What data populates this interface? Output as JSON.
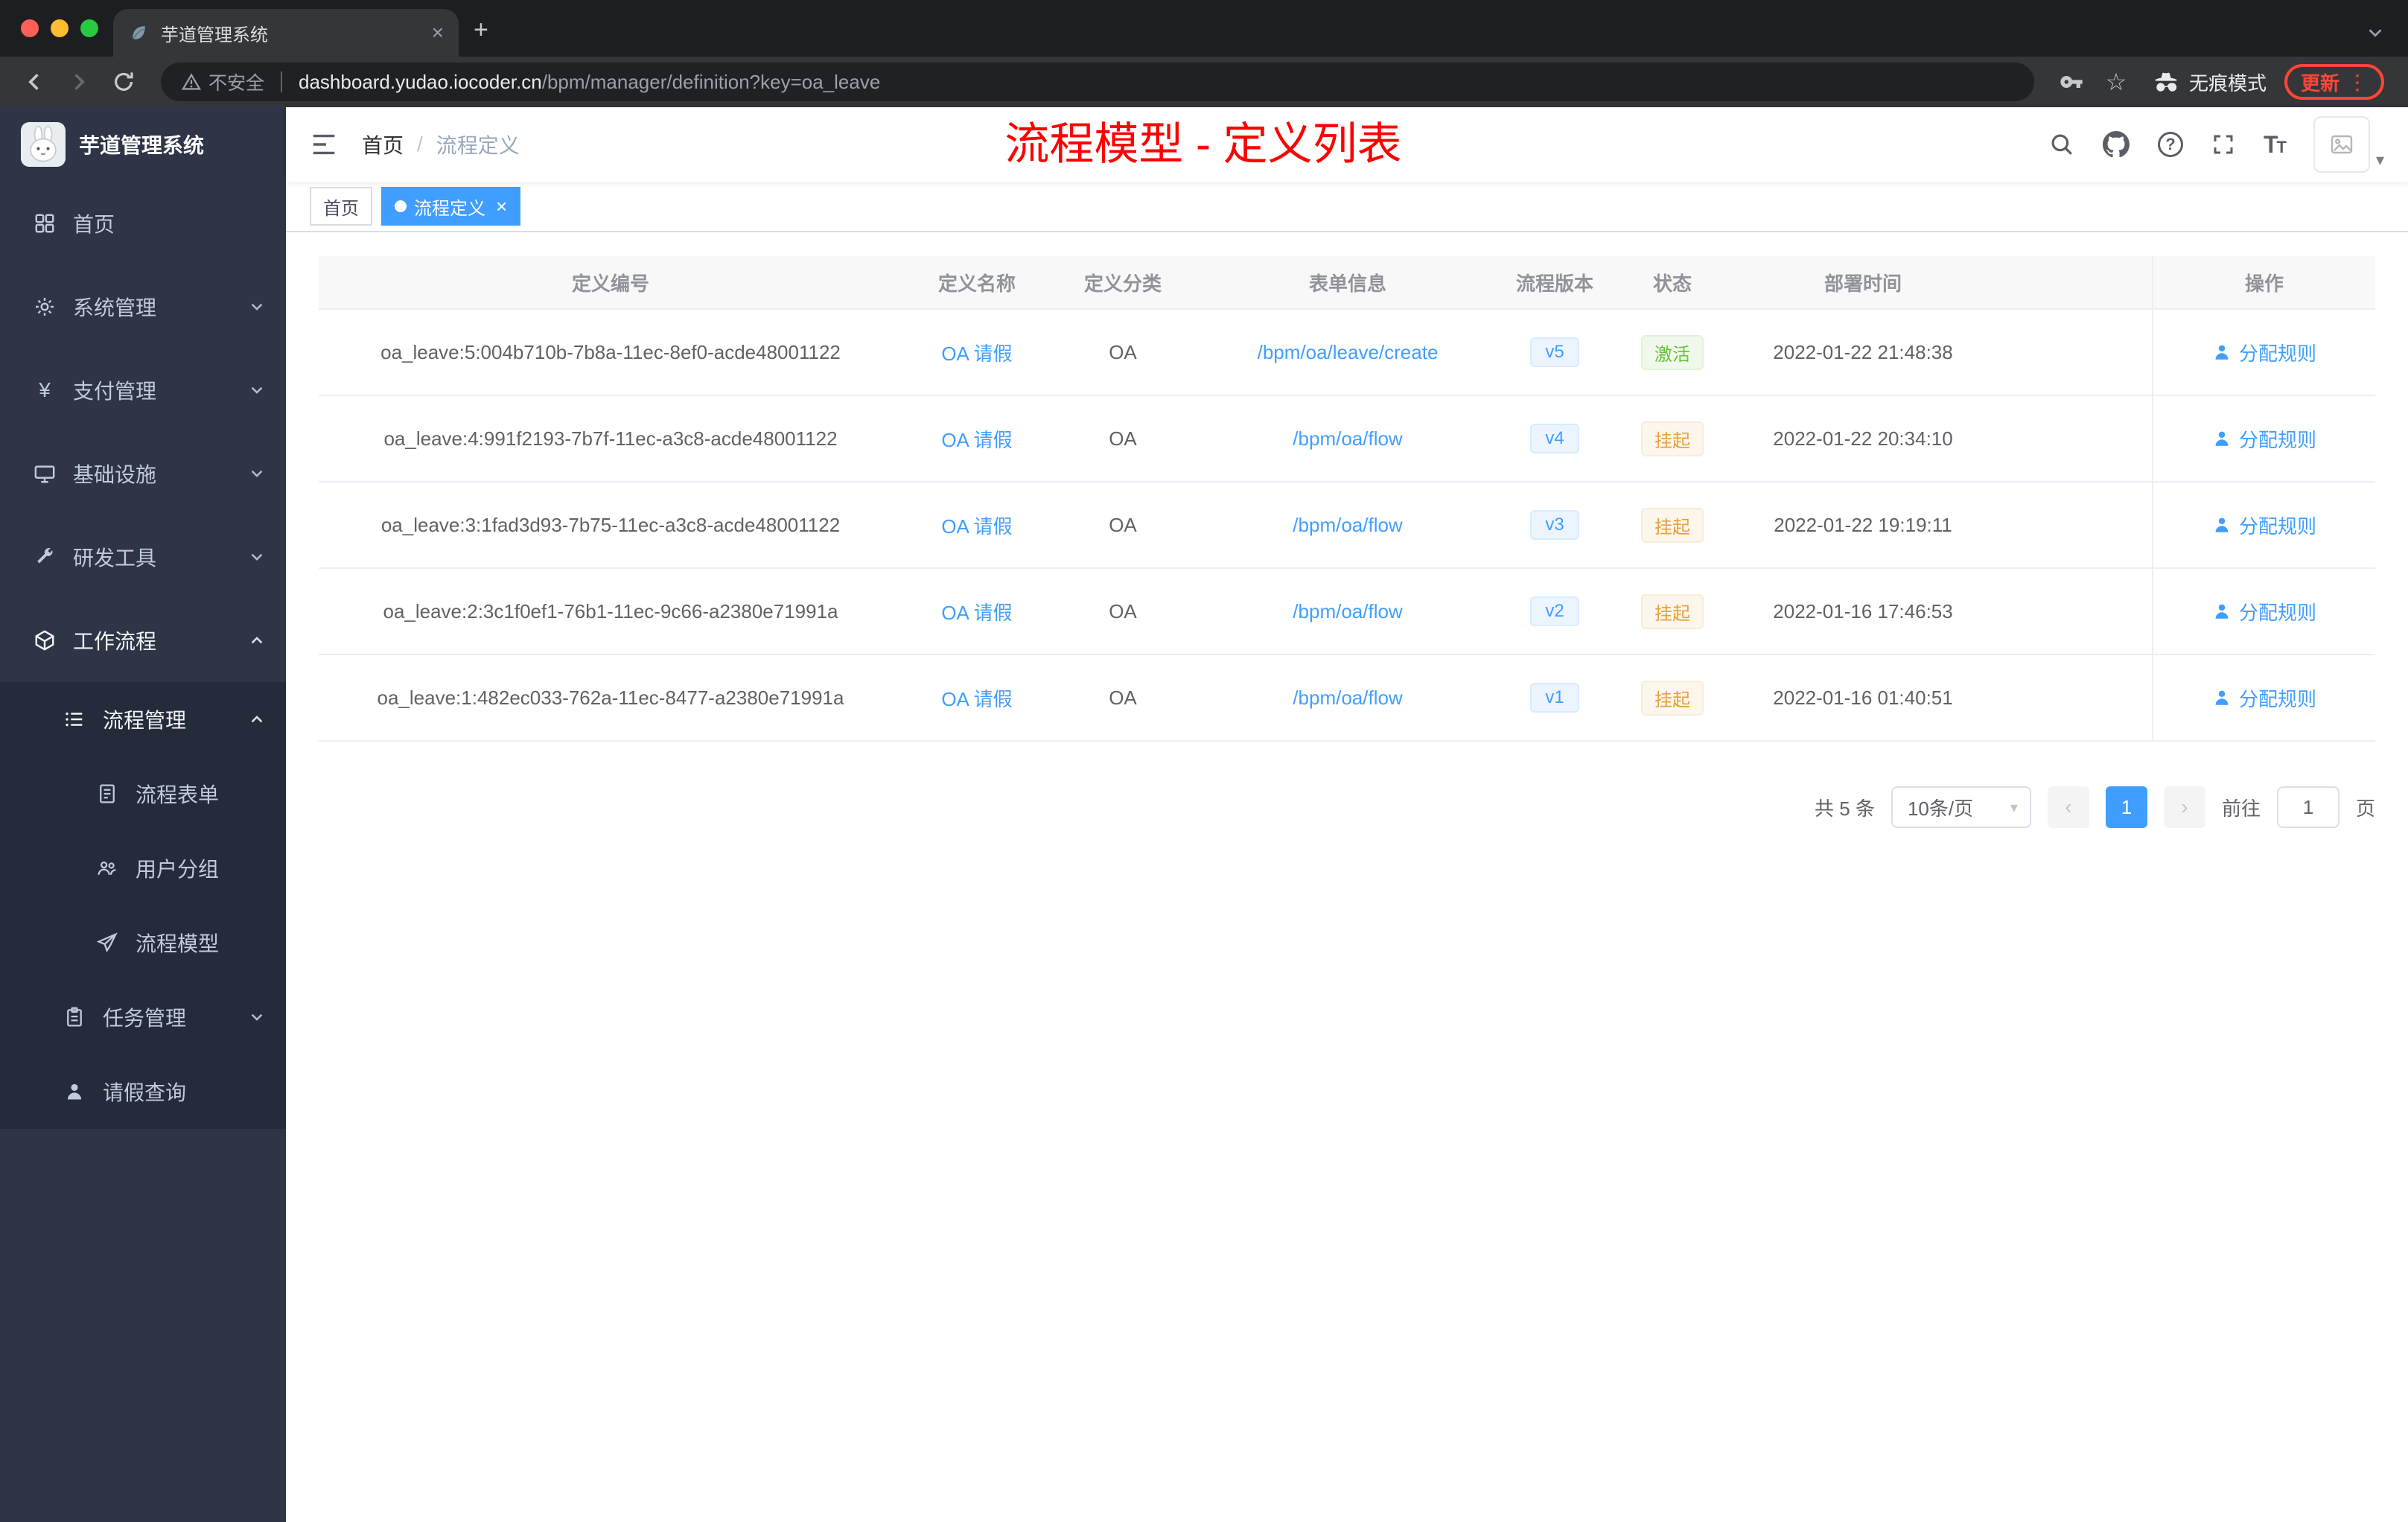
{
  "browser": {
    "tab_title": "芋道管理系统",
    "omnibox": {
      "security_label": "不安全",
      "domain": "dashboard.yudao.iocoder.cn",
      "path": "/bpm/manager/definition?key=oa_leave"
    },
    "incognito_label": "无痕模式",
    "update_label": "更新"
  },
  "sidebar": {
    "logo_title": "芋道管理系统",
    "items": [
      {
        "label": "首页"
      },
      {
        "label": "系统管理"
      },
      {
        "label": "支付管理"
      },
      {
        "label": "基础设施"
      },
      {
        "label": "研发工具"
      },
      {
        "label": "工作流程"
      },
      {
        "label": "流程管理"
      },
      {
        "label": "流程表单"
      },
      {
        "label": "用户分组"
      },
      {
        "label": "流程模型"
      },
      {
        "label": "任务管理"
      },
      {
        "label": "请假查询"
      }
    ]
  },
  "header": {
    "breadcrumb_home": "首页",
    "breadcrumb_sep": "/",
    "breadcrumb_current": "流程定义",
    "page_title": "流程模型 - 定义列表"
  },
  "tags": [
    {
      "label": "首页"
    },
    {
      "label": "流程定义"
    }
  ],
  "table": {
    "columns": [
      "定义编号",
      "定义名称",
      "定义分类",
      "表单信息",
      "流程版本",
      "状态",
      "部署时间",
      "操作"
    ],
    "rows": [
      {
        "id": "oa_leave:5:004b710b-7b8a-11ec-8ef0-acde48001122",
        "name": "OA 请假",
        "category": "OA",
        "form": "/bpm/oa/leave/create",
        "version": "v5",
        "status": "激活",
        "time": "2022-01-22 21:48:38",
        "action": "分配规则"
      },
      {
        "id": "oa_leave:4:991f2193-7b7f-11ec-a3c8-acde48001122",
        "name": "OA 请假",
        "category": "OA",
        "form": "/bpm/oa/flow",
        "version": "v4",
        "status": "挂起",
        "time": "2022-01-22 20:34:10",
        "action": "分配规则"
      },
      {
        "id": "oa_leave:3:1fad3d93-7b75-11ec-a3c8-acde48001122",
        "name": "OA 请假",
        "category": "OA",
        "form": "/bpm/oa/flow",
        "version": "v3",
        "status": "挂起",
        "time": "2022-01-22 19:19:11",
        "action": "分配规则"
      },
      {
        "id": "oa_leave:2:3c1f0ef1-76b1-11ec-9c66-a2380e71991a",
        "name": "OA 请假",
        "category": "OA",
        "form": "/bpm/oa/flow",
        "version": "v2",
        "status": "挂起",
        "time": "2022-01-16 17:46:53",
        "action": "分配规则"
      },
      {
        "id": "oa_leave:1:482ec033-762a-11ec-8477-a2380e71991a",
        "name": "OA 请假",
        "category": "OA",
        "form": "/bpm/oa/flow",
        "version": "v1",
        "status": "挂起",
        "time": "2022-01-16 01:40:51",
        "action": "分配规则"
      }
    ]
  },
  "pagination": {
    "total": "共 5 条",
    "page_size": "10条/页",
    "prev": "‹",
    "page": "1",
    "next": "›",
    "goto_label": "前往",
    "goto_value": "1",
    "goto_unit": "页"
  },
  "glyphs": {
    "close": "×",
    "plus": "+",
    "star": "☆",
    "yen": "¥",
    "caret": "▾",
    "kebab": "⋮",
    "help": "?",
    "t_large": "T",
    "t_small": "T"
  },
  "colors": {
    "accent": "#409eff",
    "success": "#67c23a",
    "warning": "#e6a23c",
    "title_red": "#ff0000",
    "sidebar_bg": "#2f3447",
    "submenu_bg": "#262b3b",
    "chrome_frame": "#1d1e21",
    "chrome_toolbar": "#35363a"
  }
}
